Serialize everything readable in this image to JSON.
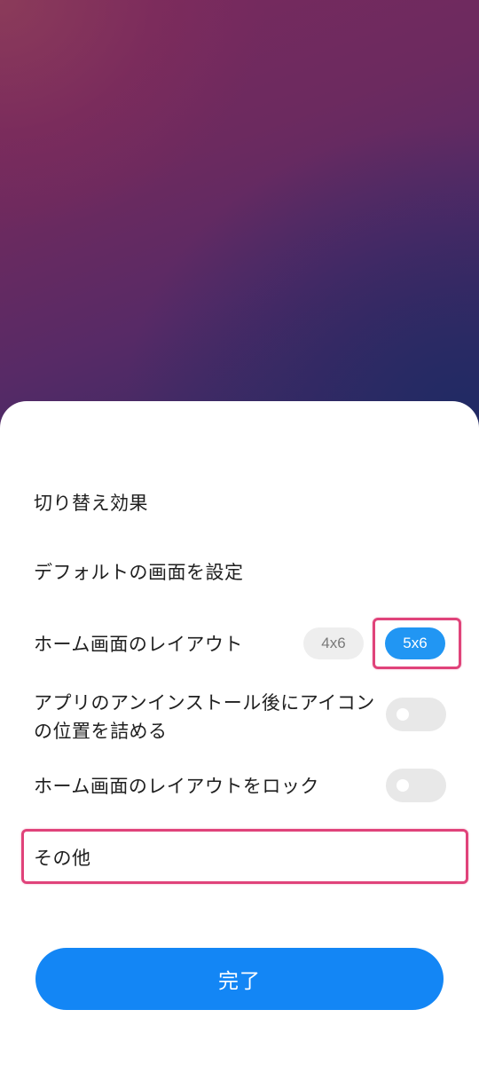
{
  "settings": {
    "items": [
      {
        "label": "切り替え効果"
      },
      {
        "label": "デフォルトの画面を設定"
      },
      {
        "label": "ホーム画面のレイアウト"
      },
      {
        "label": "アプリのアンインストール後にアイコンの位置を詰める"
      },
      {
        "label": "ホーム画面のレイアウトをロック"
      },
      {
        "label": "その他"
      }
    ],
    "layout_options": [
      {
        "label": "4x6",
        "selected": false
      },
      {
        "label": "5x6",
        "selected": true
      }
    ],
    "toggles": [
      {
        "state": "off"
      },
      {
        "state": "off"
      }
    ]
  },
  "footer": {
    "done_label": "完了"
  },
  "colors": {
    "accent": "#2196f3",
    "button": "#1386f5",
    "highlight": "#e0437a"
  }
}
